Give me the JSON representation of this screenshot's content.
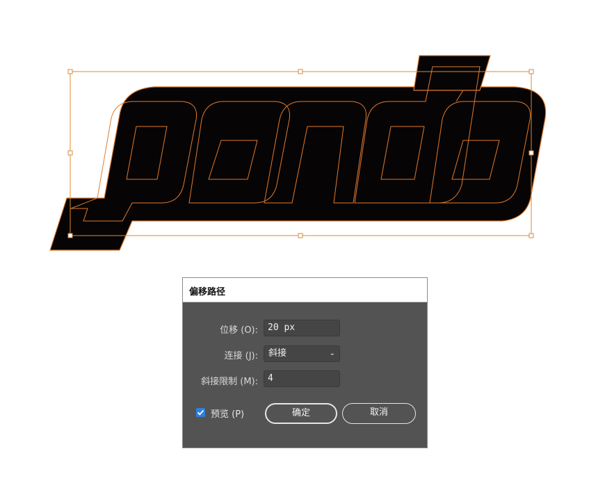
{
  "artwork": {
    "text": "panda",
    "fill_color": "#070405",
    "stroke_color": "#e07a2c",
    "selection_color": "#e08a2c"
  },
  "dialog": {
    "title": "偏移路径",
    "offset": {
      "label": "位移 (O):",
      "value": "20 px"
    },
    "joins": {
      "label": "连接 (J):",
      "value": "斜接"
    },
    "miter_limit": {
      "label": "斜接限制 (M):",
      "value": "4"
    },
    "preview": {
      "label": "预览 (P)",
      "checked": true
    },
    "ok_label": "确定",
    "cancel_label": "取消"
  }
}
